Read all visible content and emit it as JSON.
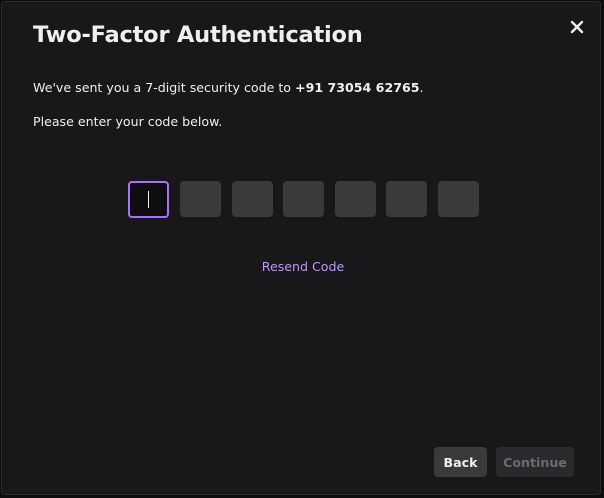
{
  "modal": {
    "title": "Two-Factor Authentication",
    "close_icon": "close-icon"
  },
  "message": {
    "prefix": "We've sent you a 7-digit security code to ",
    "phone": "+91 73054 62765",
    "suffix": "."
  },
  "instruction": "Please enter your code below.",
  "code": {
    "digits": [
      "",
      "",
      "",
      "",
      "",
      "",
      ""
    ],
    "active_index": 0
  },
  "resend_label": "Resend Code",
  "buttons": {
    "back_label": "Back",
    "continue_label": "Continue",
    "continue_disabled": true
  },
  "colors": {
    "accent": "#a970ff",
    "link": "#bf94ff",
    "modal_bg": "#18181b",
    "input_bg": "#3a3a3d"
  }
}
